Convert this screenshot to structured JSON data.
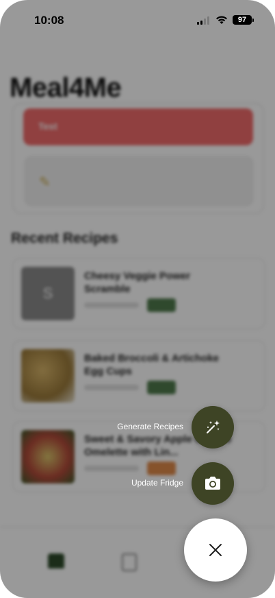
{
  "status_bar": {
    "time": "10:08",
    "battery": "97"
  },
  "background": {
    "app_title": "Meal4Me",
    "red_banner_text": "Test",
    "section_title": "Recent Recipes",
    "recipes": [
      {
        "name": "Cheesy Veggie Power Scramble",
        "thumb_letter": "S",
        "thumb_color": "#8a8a8a",
        "pill_color": "#4f7a4c"
      },
      {
        "name": "Baked Broccoli & Artichoke Egg Cups",
        "thumb_letter": "",
        "thumb_color": "#c9b27a",
        "pill_color": "#4f7a4c"
      },
      {
        "name": "Sweet & Savory Apple Cheese Omelette with Lin...",
        "thumb_letter": "",
        "thumb_color": "#b34a3a",
        "pill_color": "#e08a4a"
      }
    ]
  },
  "fab_menu": {
    "generate_label": "Generate Recipes",
    "generate_icon": "magic-wand-icon",
    "update_label": "Update Fridge",
    "update_icon": "camera-icon",
    "close_icon": "close-icon",
    "accent_color": "#3e4425"
  }
}
